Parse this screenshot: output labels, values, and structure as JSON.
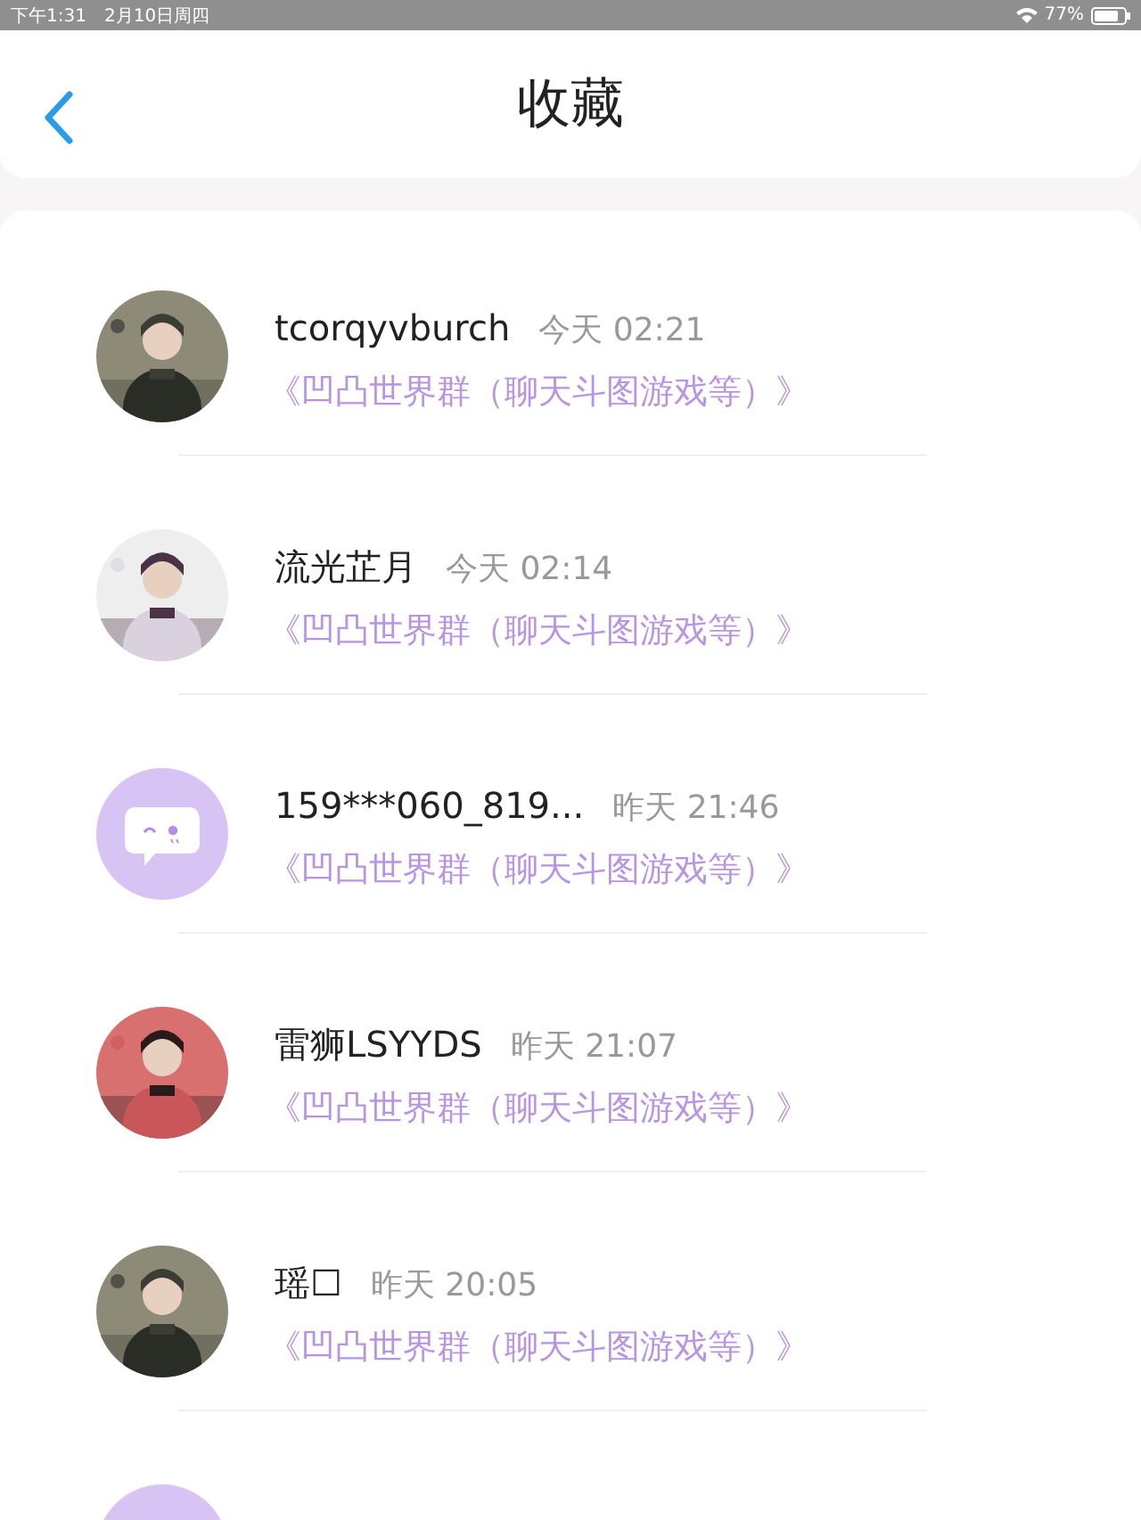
{
  "status_bar": {
    "time": "下午1:31",
    "date": "2月10日周四",
    "battery": "77%"
  },
  "header": {
    "title": "收藏"
  },
  "items": [
    {
      "kind": "picture",
      "name": "tcorqyvburch",
      "time": "今天 02:21",
      "group": "《凹凸世界群（聊天斗图游戏等）》"
    },
    {
      "kind": "picture",
      "name": "流光芷月",
      "time": "今天 02:14",
      "group": "《凹凸世界群（聊天斗图游戏等）》"
    },
    {
      "kind": "default",
      "name": "159***060_819...",
      "time": "昨天 21:46",
      "group": "《凹凸世界群（聊天斗图游戏等）》"
    },
    {
      "kind": "picture",
      "name": "雷狮LSYYDS",
      "time": "昨天 21:07",
      "group": "《凹凸世界群（聊天斗图游戏等）》"
    },
    {
      "kind": "picture",
      "name": "瑶☐",
      "time": "昨天 20:05",
      "group": "《凹凸世界群（聊天斗图游戏等）》"
    },
    {
      "kind": "default"
    }
  ]
}
